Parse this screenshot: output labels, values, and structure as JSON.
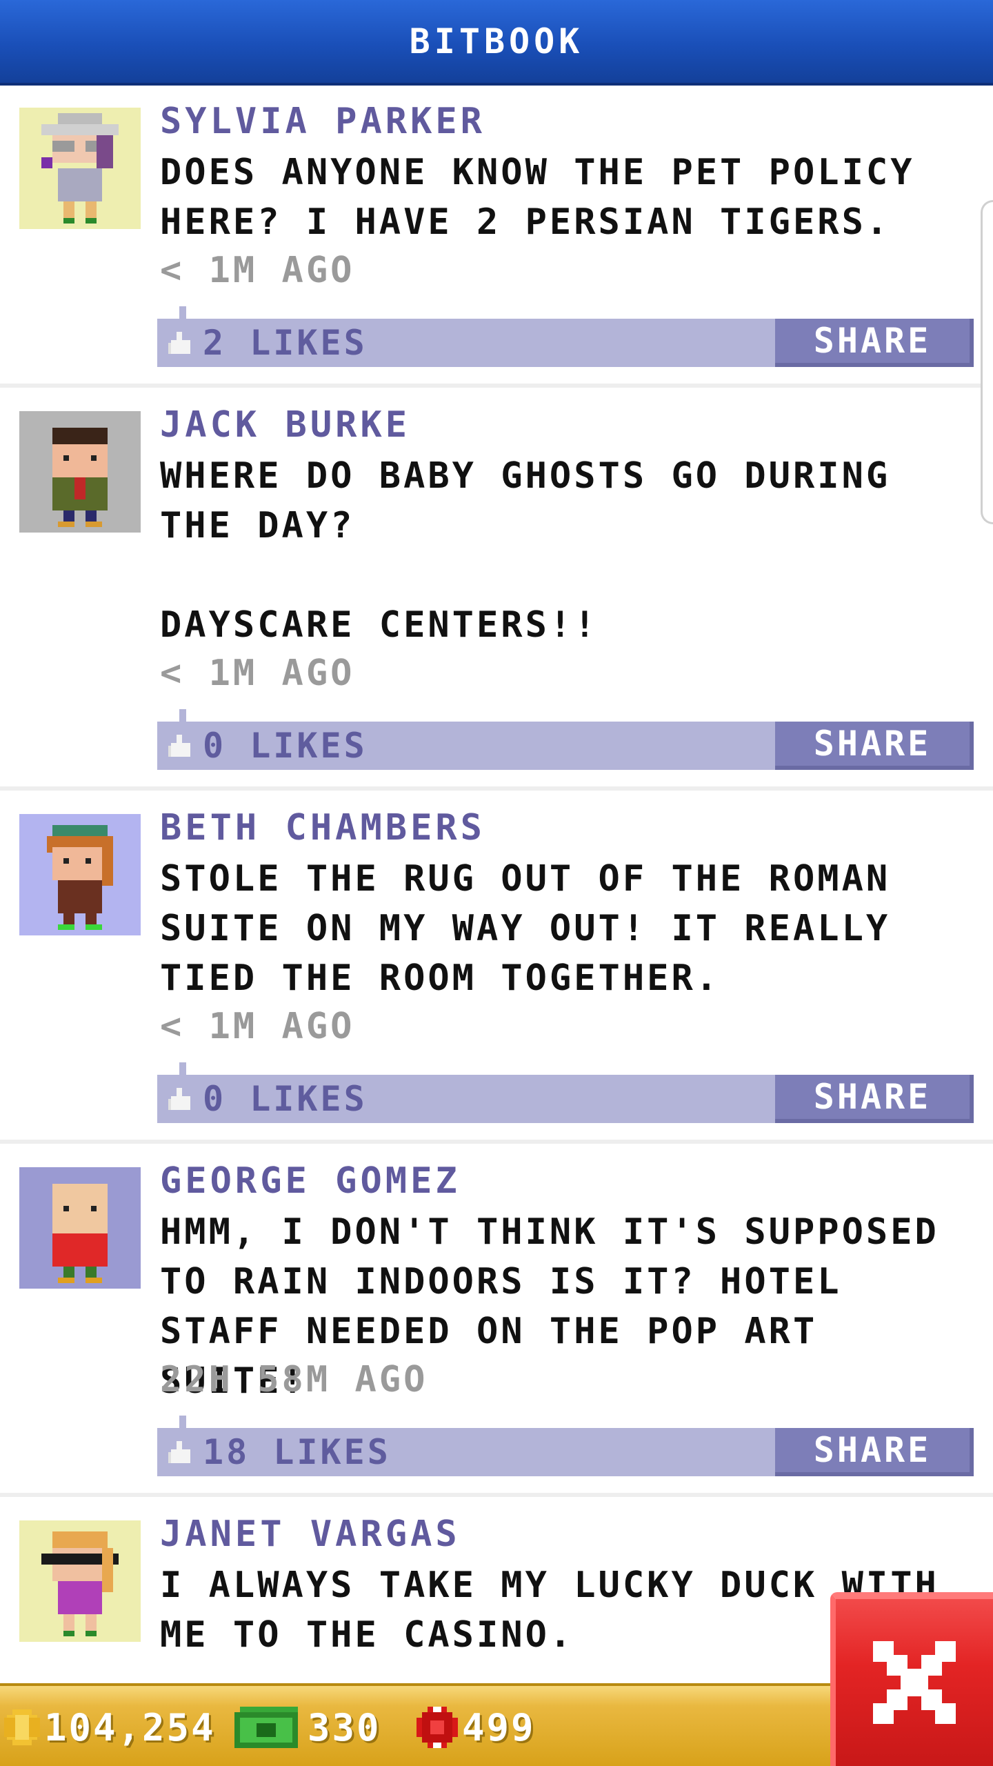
{
  "header": {
    "title": "BITBOOK"
  },
  "posts": [
    {
      "author": "SYLVIA PARKER",
      "message": "DOES ANYONE KNOW THE PET POLICY HERE? I HAVE 2 PERSIAN TIGERS.",
      "time": "< 1M AGO",
      "likes_label": "2 LIKES",
      "share_label": "SHARE",
      "avatar": "sylvia-parker-avatar",
      "avatar_bg": "#eeeeb0"
    },
    {
      "author": "JACK BURKE",
      "message": "WHERE DO BABY GHOSTS GO DURING THE DAY?\n\nDAYSCARE CENTERS!!",
      "time": "< 1M AGO",
      "likes_label": "0 LIKES",
      "share_label": "SHARE",
      "avatar": "jack-burke-avatar",
      "avatar_bg": "#b5b5b5"
    },
    {
      "author": "BETH CHAMBERS",
      "message": "STOLE THE RUG OUT OF THE ROMAN SUITE ON MY WAY OUT! IT REALLY TIED THE ROOM TOGETHER.",
      "time": "< 1M AGO",
      "likes_label": "0 LIKES",
      "share_label": "SHARE",
      "avatar": "beth-chambers-avatar",
      "avatar_bg": "#b3b4f0"
    },
    {
      "author": "GEORGE GOMEZ",
      "message": "HMM, I DON'T THINK IT'S SUPPOSED TO RAIN INDOORS IS IT? HOTEL STAFF NEEDED ON THE POP ART SUITE!",
      "time": "22H 58M AGO",
      "likes_label": "18 LIKES",
      "share_label": "SHARE",
      "avatar": "george-gomez-avatar",
      "avatar_bg": "#9a9ad2"
    },
    {
      "author": "JANET VARGAS",
      "message": "I ALWAYS TAKE MY LUCKY DUCK WITH ME TO THE CASINO.",
      "time": "",
      "likes_label": "",
      "share_label": "",
      "avatar": "janet-vargas-avatar",
      "avatar_bg": "#eeeeb0"
    }
  ],
  "bottom_bar": {
    "coins": "104,254",
    "bux": "330",
    "chips": "499"
  },
  "icons": {
    "coin": "coin-icon",
    "bux": "bux-icon",
    "chip": "casino-chip-icon",
    "close": "close-icon",
    "like": "thumbs-up-icon"
  },
  "colors": {
    "header": "#1a4fb8",
    "author": "#605a9e",
    "action_bar": "#b3b4d8",
    "share_button": "#7d7eb8",
    "close_button": "#e32424",
    "bottom_bar": "#e9b840"
  }
}
